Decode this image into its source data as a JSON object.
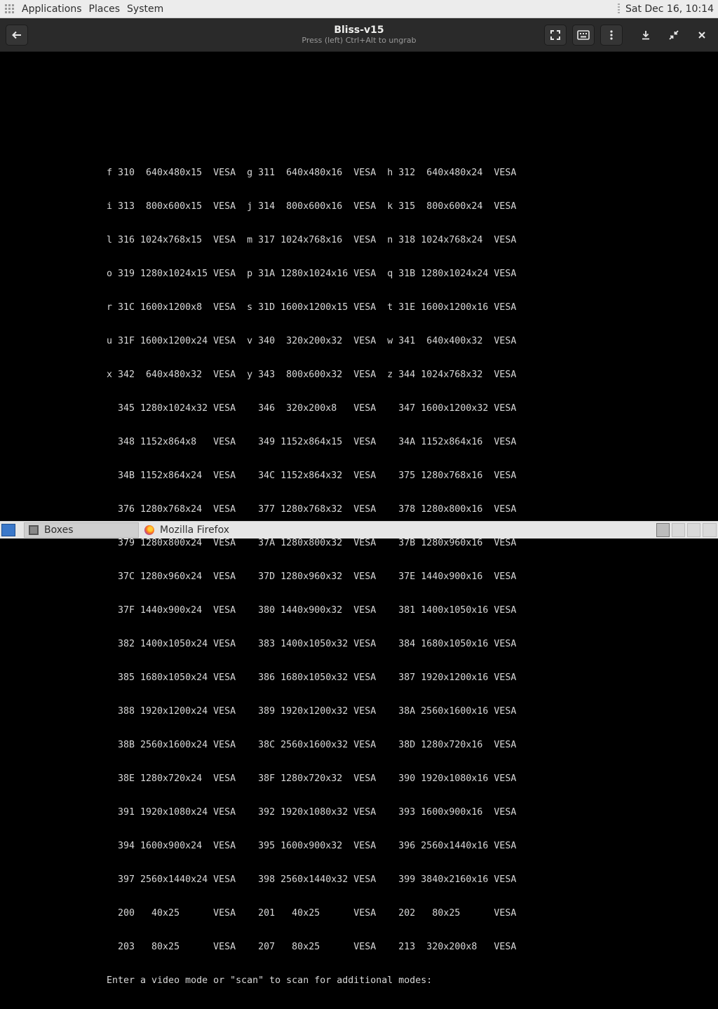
{
  "top_panel": {
    "menus": [
      "Applications",
      "Places",
      "System"
    ],
    "clock": "Sat Dec 16, 10:14"
  },
  "header": {
    "title": "Bliss-v15",
    "subtitle": "Press (left) Ctrl+Alt to ungrab",
    "icons": [
      "back-arrow-icon",
      "fullscreen-icon",
      "keyboard-icon",
      "more-vertical-icon",
      "download-icon",
      "restore-icon",
      "close-icon"
    ]
  },
  "console": {
    "lines": [
      "f 310  640x480x15  VESA  g 311  640x480x16  VESA  h 312  640x480x24  VESA",
      "i 313  800x600x15  VESA  j 314  800x600x16  VESA  k 315  800x600x24  VESA",
      "l 316 1024x768x15  VESA  m 317 1024x768x16  VESA  n 318 1024x768x24  VESA",
      "o 319 1280x1024x15 VESA  p 31A 1280x1024x16 VESA  q 31B 1280x1024x24 VESA",
      "r 31C 1600x1200x8  VESA  s 31D 1600x1200x15 VESA  t 31E 1600x1200x16 VESA",
      "u 31F 1600x1200x24 VESA  v 340  320x200x32  VESA  w 341  640x400x32  VESA",
      "x 342  640x480x32  VESA  y 343  800x600x32  VESA  z 344 1024x768x32  VESA",
      "  345 1280x1024x32 VESA    346  320x200x8   VESA    347 1600x1200x32 VESA",
      "  348 1152x864x8   VESA    349 1152x864x15  VESA    34A 1152x864x16  VESA",
      "  34B 1152x864x24  VESA    34C 1152x864x32  VESA    375 1280x768x16  VESA",
      "  376 1280x768x24  VESA    377 1280x768x32  VESA    378 1280x800x16  VESA",
      "  379 1280x800x24  VESA    37A 1280x800x32  VESA    37B 1280x960x16  VESA",
      "  37C 1280x960x24  VESA    37D 1280x960x32  VESA    37E 1440x900x16  VESA",
      "  37F 1440x900x24  VESA    380 1440x900x32  VESA    381 1400x1050x16 VESA",
      "  382 1400x1050x24 VESA    383 1400x1050x32 VESA    384 1680x1050x16 VESA",
      "  385 1680x1050x24 VESA    386 1680x1050x32 VESA    387 1920x1200x16 VESA",
      "  388 1920x1200x24 VESA    389 1920x1200x32 VESA    38A 2560x1600x16 VESA",
      "  38B 2560x1600x24 VESA    38C 2560x1600x32 VESA    38D 1280x720x16  VESA",
      "  38E 1280x720x24  VESA    38F 1280x720x32  VESA    390 1920x1080x16 VESA",
      "  391 1920x1080x24 VESA    392 1920x1080x32 VESA    393 1600x900x16  VESA",
      "  394 1600x900x24  VESA    395 1600x900x32  VESA    396 2560x1440x16 VESA",
      "  397 2560x1440x24 VESA    398 2560x1440x32 VESA    399 3840x2160x16 VESA",
      "  200   40x25      VESA    201   40x25      VESA    202   80x25      VESA",
      "  203   80x25      VESA    207   80x25      VESA    213  320x200x8   VESA",
      "Enter a video mode or \"scan\" to scan for additional modes:"
    ]
  },
  "taskbar": {
    "tasks": [
      {
        "label": "Boxes",
        "icon": "boxes-icon"
      },
      {
        "label": "Mozilla Firefox",
        "icon": "firefox-icon"
      }
    ]
  }
}
